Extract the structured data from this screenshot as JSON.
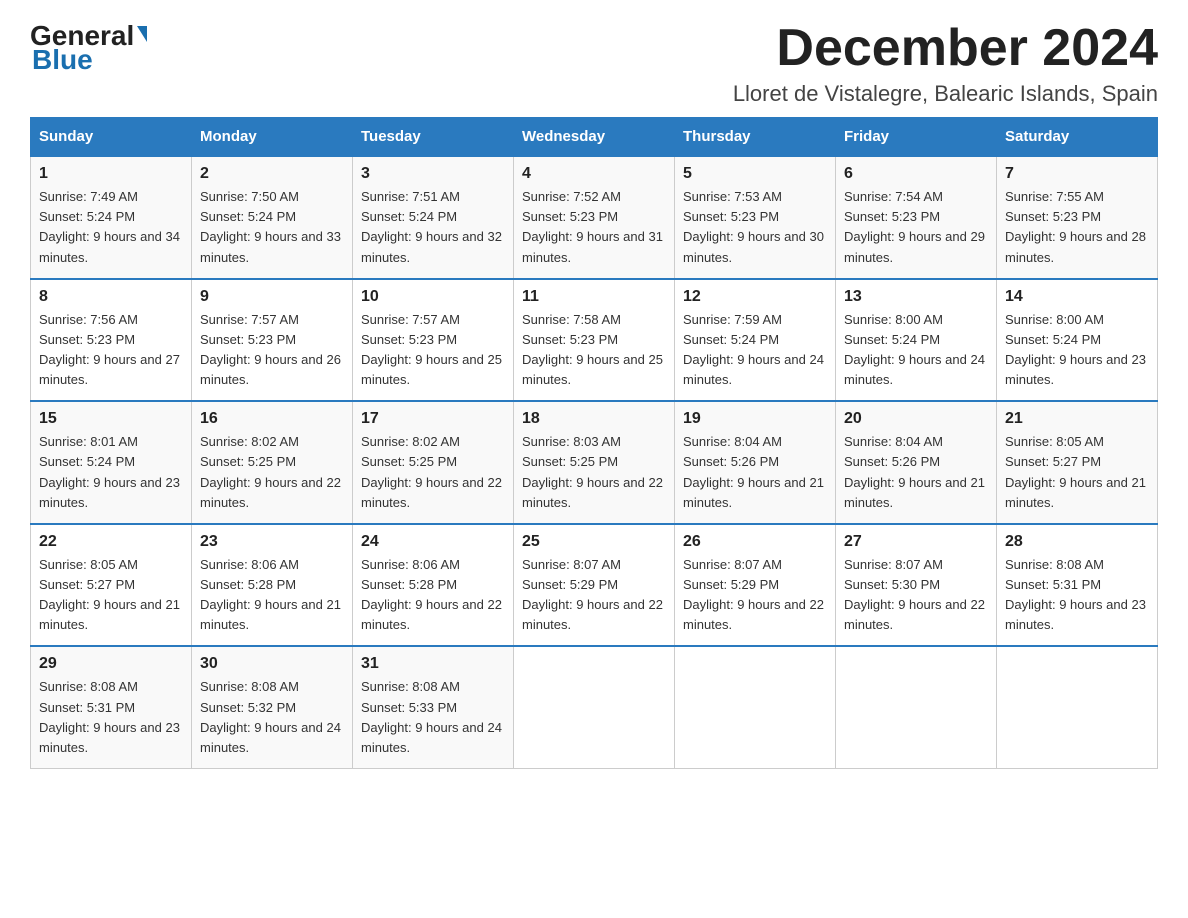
{
  "logo": {
    "general": "General",
    "blue": "Blue",
    "arrow": "▶"
  },
  "header": {
    "month_title": "December 2024",
    "location": "Lloret de Vistalegre, Balearic Islands, Spain"
  },
  "days_of_week": [
    "Sunday",
    "Monday",
    "Tuesday",
    "Wednesday",
    "Thursday",
    "Friday",
    "Saturday"
  ],
  "weeks": [
    [
      {
        "num": "1",
        "sunrise": "7:49 AM",
        "sunset": "5:24 PM",
        "daylight": "9 hours and 34 minutes."
      },
      {
        "num": "2",
        "sunrise": "7:50 AM",
        "sunset": "5:24 PM",
        "daylight": "9 hours and 33 minutes."
      },
      {
        "num": "3",
        "sunrise": "7:51 AM",
        "sunset": "5:24 PM",
        "daylight": "9 hours and 32 minutes."
      },
      {
        "num": "4",
        "sunrise": "7:52 AM",
        "sunset": "5:23 PM",
        "daylight": "9 hours and 31 minutes."
      },
      {
        "num": "5",
        "sunrise": "7:53 AM",
        "sunset": "5:23 PM",
        "daylight": "9 hours and 30 minutes."
      },
      {
        "num": "6",
        "sunrise": "7:54 AM",
        "sunset": "5:23 PM",
        "daylight": "9 hours and 29 minutes."
      },
      {
        "num": "7",
        "sunrise": "7:55 AM",
        "sunset": "5:23 PM",
        "daylight": "9 hours and 28 minutes."
      }
    ],
    [
      {
        "num": "8",
        "sunrise": "7:56 AM",
        "sunset": "5:23 PM",
        "daylight": "9 hours and 27 minutes."
      },
      {
        "num": "9",
        "sunrise": "7:57 AM",
        "sunset": "5:23 PM",
        "daylight": "9 hours and 26 minutes."
      },
      {
        "num": "10",
        "sunrise": "7:57 AM",
        "sunset": "5:23 PM",
        "daylight": "9 hours and 25 minutes."
      },
      {
        "num": "11",
        "sunrise": "7:58 AM",
        "sunset": "5:23 PM",
        "daylight": "9 hours and 25 minutes."
      },
      {
        "num": "12",
        "sunrise": "7:59 AM",
        "sunset": "5:24 PM",
        "daylight": "9 hours and 24 minutes."
      },
      {
        "num": "13",
        "sunrise": "8:00 AM",
        "sunset": "5:24 PM",
        "daylight": "9 hours and 24 minutes."
      },
      {
        "num": "14",
        "sunrise": "8:00 AM",
        "sunset": "5:24 PM",
        "daylight": "9 hours and 23 minutes."
      }
    ],
    [
      {
        "num": "15",
        "sunrise": "8:01 AM",
        "sunset": "5:24 PM",
        "daylight": "9 hours and 23 minutes."
      },
      {
        "num": "16",
        "sunrise": "8:02 AM",
        "sunset": "5:25 PM",
        "daylight": "9 hours and 22 minutes."
      },
      {
        "num": "17",
        "sunrise": "8:02 AM",
        "sunset": "5:25 PM",
        "daylight": "9 hours and 22 minutes."
      },
      {
        "num": "18",
        "sunrise": "8:03 AM",
        "sunset": "5:25 PM",
        "daylight": "9 hours and 22 minutes."
      },
      {
        "num": "19",
        "sunrise": "8:04 AM",
        "sunset": "5:26 PM",
        "daylight": "9 hours and 21 minutes."
      },
      {
        "num": "20",
        "sunrise": "8:04 AM",
        "sunset": "5:26 PM",
        "daylight": "9 hours and 21 minutes."
      },
      {
        "num": "21",
        "sunrise": "8:05 AM",
        "sunset": "5:27 PM",
        "daylight": "9 hours and 21 minutes."
      }
    ],
    [
      {
        "num": "22",
        "sunrise": "8:05 AM",
        "sunset": "5:27 PM",
        "daylight": "9 hours and 21 minutes."
      },
      {
        "num": "23",
        "sunrise": "8:06 AM",
        "sunset": "5:28 PM",
        "daylight": "9 hours and 21 minutes."
      },
      {
        "num": "24",
        "sunrise": "8:06 AM",
        "sunset": "5:28 PM",
        "daylight": "9 hours and 22 minutes."
      },
      {
        "num": "25",
        "sunrise": "8:07 AM",
        "sunset": "5:29 PM",
        "daylight": "9 hours and 22 minutes."
      },
      {
        "num": "26",
        "sunrise": "8:07 AM",
        "sunset": "5:29 PM",
        "daylight": "9 hours and 22 minutes."
      },
      {
        "num": "27",
        "sunrise": "8:07 AM",
        "sunset": "5:30 PM",
        "daylight": "9 hours and 22 minutes."
      },
      {
        "num": "28",
        "sunrise": "8:08 AM",
        "sunset": "5:31 PM",
        "daylight": "9 hours and 23 minutes."
      }
    ],
    [
      {
        "num": "29",
        "sunrise": "8:08 AM",
        "sunset": "5:31 PM",
        "daylight": "9 hours and 23 minutes."
      },
      {
        "num": "30",
        "sunrise": "8:08 AM",
        "sunset": "5:32 PM",
        "daylight": "9 hours and 24 minutes."
      },
      {
        "num": "31",
        "sunrise": "8:08 AM",
        "sunset": "5:33 PM",
        "daylight": "9 hours and 24 minutes."
      },
      null,
      null,
      null,
      null
    ]
  ]
}
